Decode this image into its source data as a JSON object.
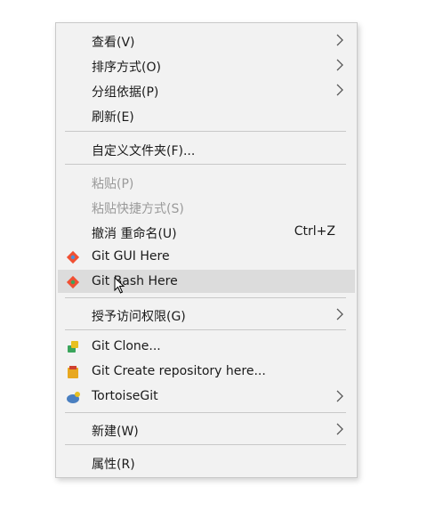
{
  "menu": {
    "items": [
      {
        "label": "查看(V)",
        "submenu": true
      },
      {
        "label": "排序方式(O)",
        "submenu": true
      },
      {
        "label": "分组依据(P)",
        "submenu": true
      },
      {
        "label": "刷新(E)"
      },
      {
        "label": "自定义文件夹(F)..."
      },
      {
        "label": "粘贴(P)",
        "disabled": true
      },
      {
        "label": "粘贴快捷方式(S)",
        "disabled": true
      },
      {
        "label": "撤消 重命名(U)",
        "shortcut": "Ctrl+Z"
      },
      {
        "label": "Git GUI Here",
        "icon": "git-gui-icon"
      },
      {
        "label": "Git Bash Here",
        "icon": "git-bash-icon",
        "hover": true
      },
      {
        "label": "授予访问权限(G)",
        "submenu": true
      },
      {
        "label": "Git Clone...",
        "icon": "tortoisegit-clone-icon"
      },
      {
        "label": "Git Create repository here...",
        "icon": "tortoisegit-create-repo-icon"
      },
      {
        "label": "TortoiseGit",
        "icon": "tortoisegit-icon",
        "submenu": true
      },
      {
        "label": "新建(W)",
        "submenu": true
      },
      {
        "label": "属性(R)"
      }
    ]
  },
  "colors": {
    "menu_bg": "#f2f2f2",
    "hover_bg": "#dcdcdc",
    "disabled_text": "#9a9a9a",
    "git_orange": "#f05033",
    "git_blue": "#4a90d9",
    "git_green": "#3ba55c"
  }
}
